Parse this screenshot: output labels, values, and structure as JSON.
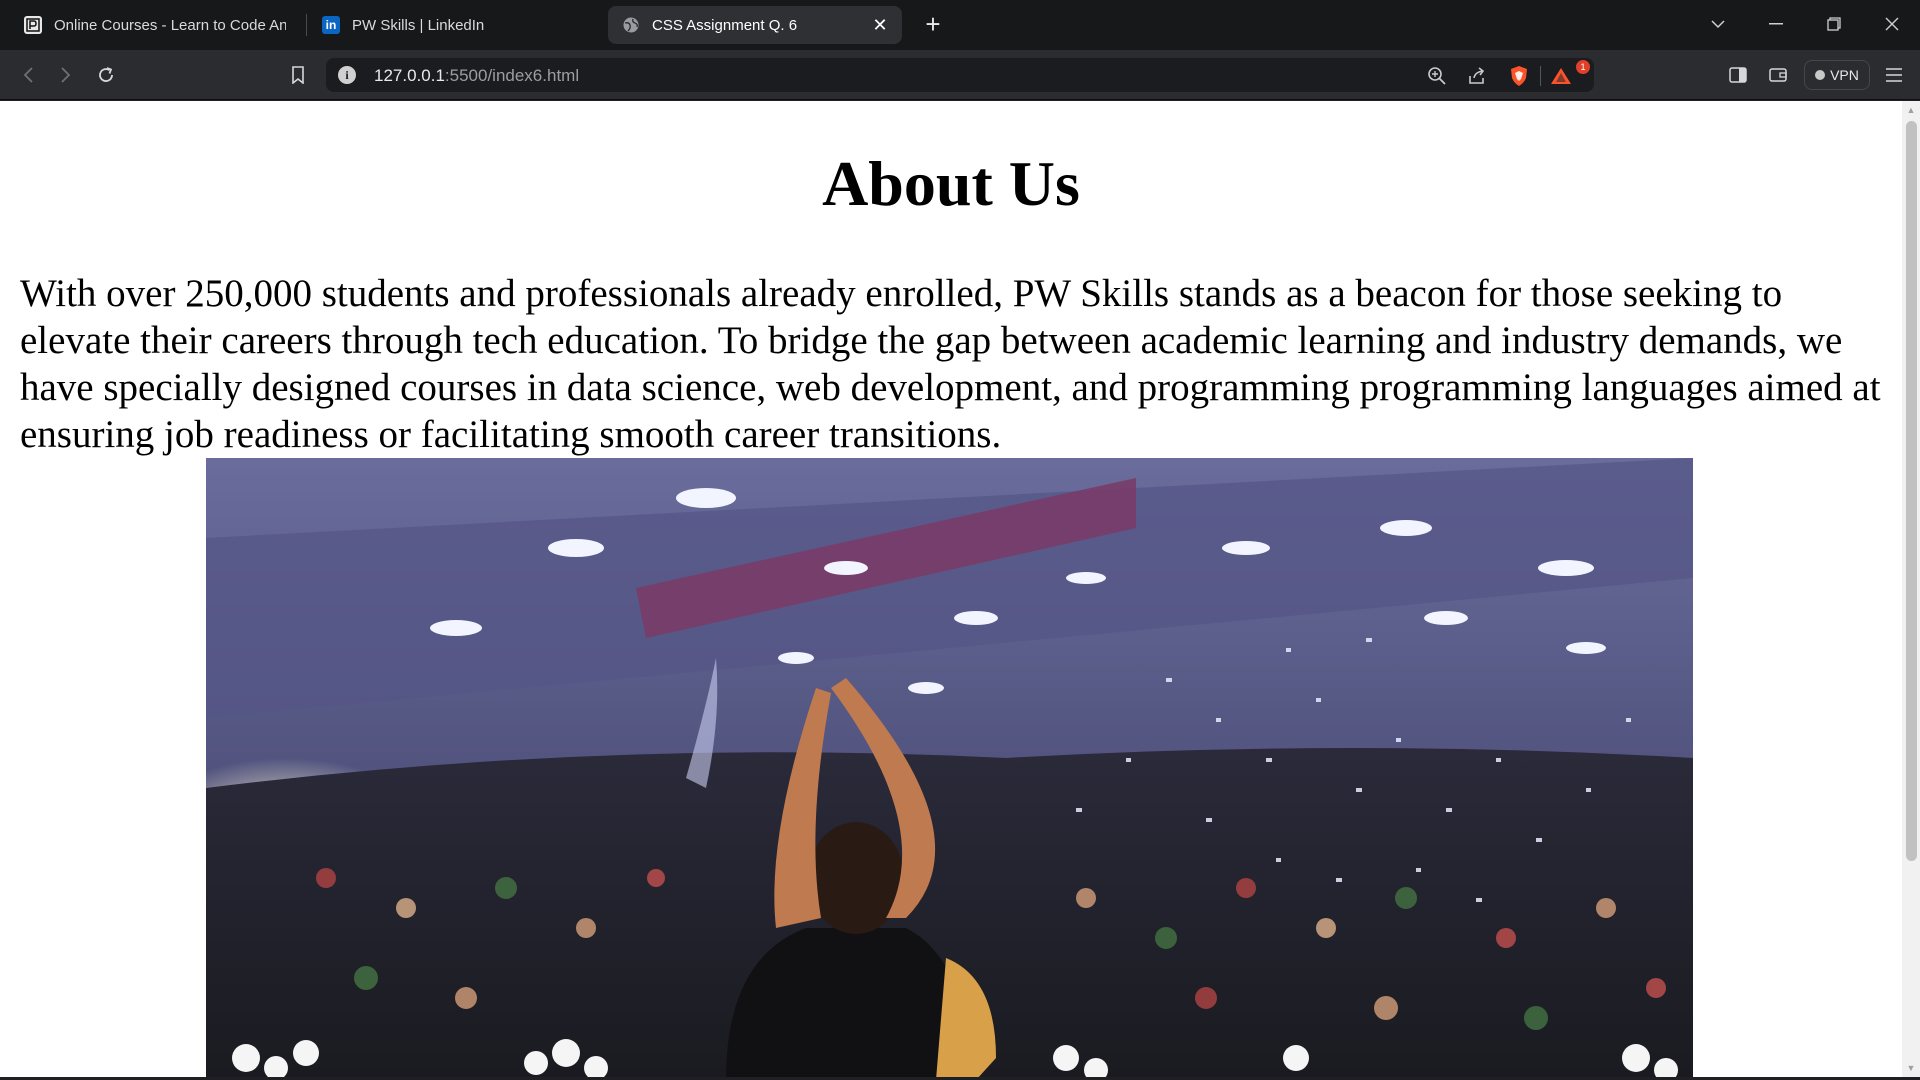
{
  "tabs": [
    {
      "title": "Online Courses - Learn to Code Anyw",
      "icon": "pw-logo-icon",
      "active": false
    },
    {
      "title": "PW Skills | LinkedIn",
      "icon": "linkedin-icon",
      "active": false
    },
    {
      "title": "CSS Assignment Q. 6",
      "icon": "globe-icon",
      "active": true
    }
  ],
  "toolbar": {
    "url_host": "127.0.0.1",
    "url_rest": ":5500/index6.html",
    "vpn_label": "VPN",
    "notification_count": "1"
  },
  "page": {
    "heading": "About Us",
    "paragraph": "With over 250,000 students and professionals already enrolled, PW Skills stands as a beacon for those seeking to elevate their careers through tech education. To bridge the gap between academic learning and industry demands, we have specially designed courses in data science, web development, and programming programming languages aimed at ensuring job readiness or facilitating smooth career transitions."
  },
  "colors": {
    "tabstrip_bg": "#17181a",
    "toolbar_bg": "#2b2c30",
    "page_bg": "#ffffff",
    "brave_orange": "#fb542b"
  }
}
